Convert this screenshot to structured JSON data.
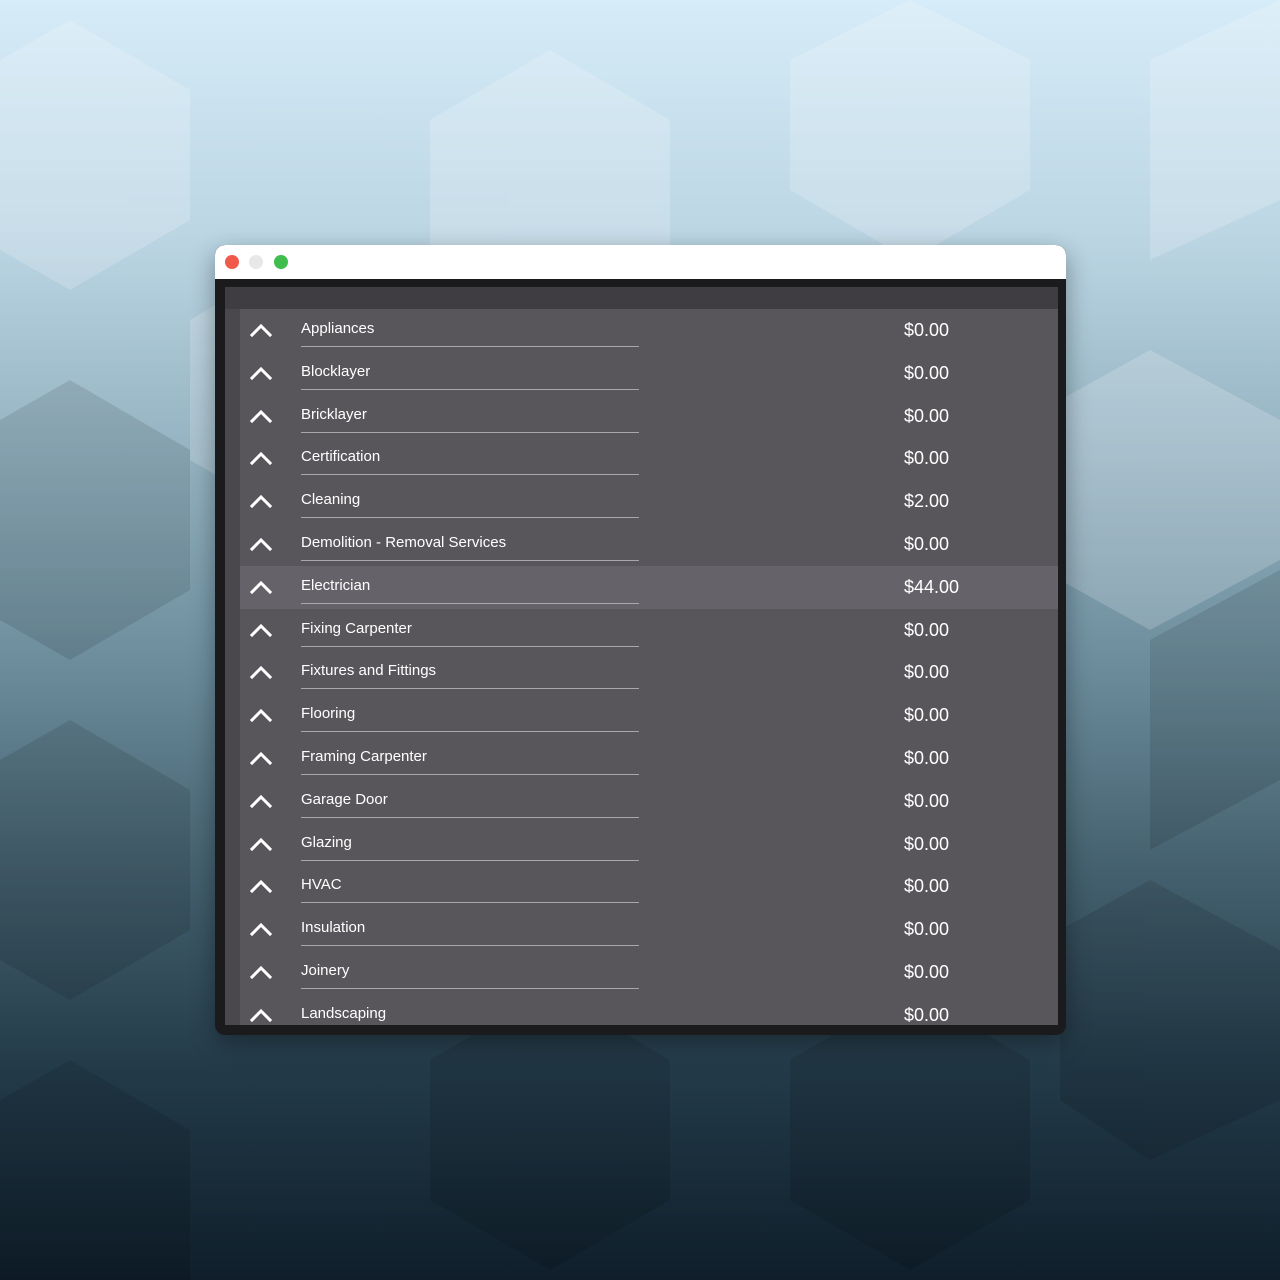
{
  "window": {
    "controls": {
      "close": "close-dot",
      "minimize": "minimize-dot",
      "maximize": "maximize-dot"
    }
  },
  "colors": {
    "accent_close": "#f05a4a",
    "accent_maximize": "#3fbe4e",
    "list_background": "#58565a",
    "highlight_row": "#656369"
  },
  "icons": {
    "row_toggle": "chevron-up-icon"
  },
  "list": {
    "items": [
      {
        "label": "Appliances",
        "amount": "$0.00"
      },
      {
        "label": "Blocklayer",
        "amount": "$0.00"
      },
      {
        "label": "Bricklayer",
        "amount": "$0.00"
      },
      {
        "label": "Certification",
        "amount": "$0.00"
      },
      {
        "label": "Cleaning",
        "amount": "$2.00"
      },
      {
        "label": "Demolition - Removal Services",
        "amount": "$0.00"
      },
      {
        "label": "Electrician",
        "amount": "$44.00"
      },
      {
        "label": "Fixing Carpenter",
        "amount": "$0.00"
      },
      {
        "label": "Fixtures and Fittings",
        "amount": "$0.00"
      },
      {
        "label": "Flooring",
        "amount": "$0.00"
      },
      {
        "label": "Framing Carpenter",
        "amount": "$0.00"
      },
      {
        "label": "Garage Door",
        "amount": "$0.00"
      },
      {
        "label": "Glazing",
        "amount": "$0.00"
      },
      {
        "label": "HVAC",
        "amount": "$0.00"
      },
      {
        "label": "Insulation",
        "amount": "$0.00"
      },
      {
        "label": "Joinery",
        "amount": "$0.00"
      },
      {
        "label": "Landscaping",
        "amount": "$0.00"
      }
    ]
  }
}
